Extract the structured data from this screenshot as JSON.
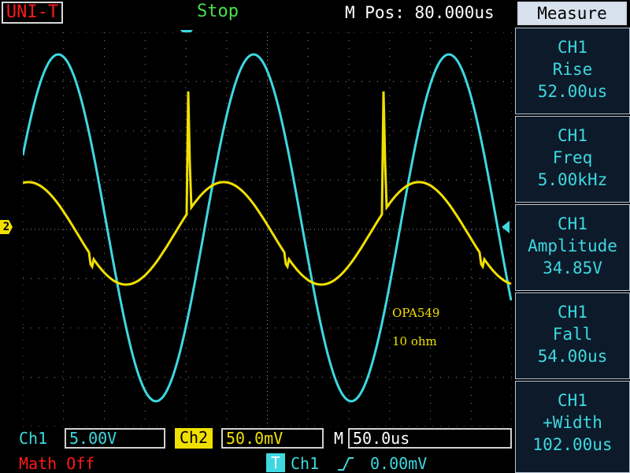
{
  "header": {
    "brand": "UNI-T",
    "run_state": "Stop",
    "m_pos_label": "M Pos:",
    "m_pos_value": "80.000us"
  },
  "markers": {
    "ch2": "2"
  },
  "annotation": {
    "line1": "OPA549",
    "line2": "10 ohm"
  },
  "panel": {
    "title": "Measure",
    "items": [
      {
        "channel": "CH1",
        "name": "Rise",
        "value": "52.00us"
      },
      {
        "channel": "CH1",
        "name": "Freq",
        "value": "5.00kHz"
      },
      {
        "channel": "CH1",
        "name": "Amplitude",
        "value": "34.85V"
      },
      {
        "channel": "CH1",
        "name": "Fall",
        "value": "54.00us"
      },
      {
        "channel": "CH1",
        "name": "+Width",
        "value": "102.00us"
      }
    ]
  },
  "footer": {
    "ch1_label": "Ch1",
    "ch1_scale": "5.00V",
    "ch2_label": "Ch2",
    "ch2_scale": "50.0mV",
    "time_label": "M",
    "time_scale": "50.0us",
    "math": "Math Off",
    "trig_badge": "T",
    "trig_source": "Ch1",
    "trig_level": "0.00mV"
  },
  "colors": {
    "ch1": "#3ed8e0",
    "ch2": "#f0e000",
    "brand": "#ff1a1a",
    "run": "#48e04a",
    "math": "#ff1a1a"
  }
}
